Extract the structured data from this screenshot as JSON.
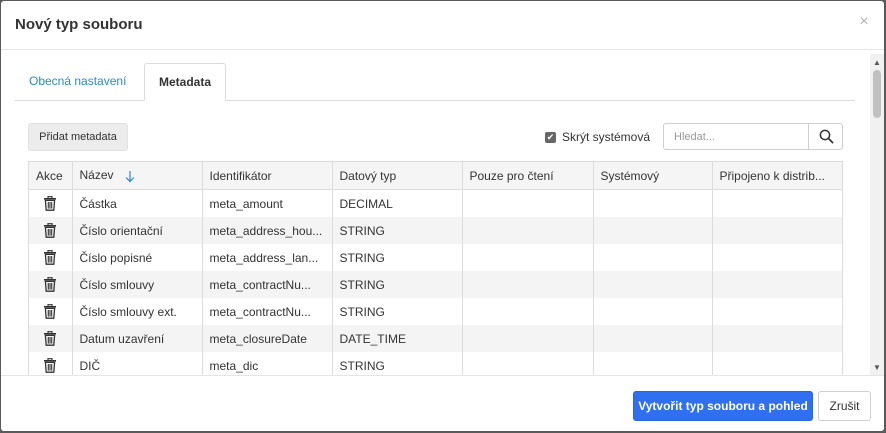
{
  "dialog": {
    "title": "Nový typ souboru",
    "close_glyph": "×",
    "close_icon": "close-icon"
  },
  "tabs": [
    {
      "label": "Obecná nastavení",
      "active": false
    },
    {
      "label": "Metadata",
      "active": true
    }
  ],
  "toolbar": {
    "add_label": "Přidat metadata",
    "hide_system_label": "Skrýt systémová",
    "hide_system_checked": true,
    "search_placeholder": "Hledat...",
    "search_icon": "search-icon"
  },
  "table": {
    "columns": [
      "Akce",
      "Název",
      "Identifikátor",
      "Datový typ",
      "Pouze pro čtení",
      "Systémový",
      "Připojeno k distrib..."
    ],
    "sort_column": "Název",
    "sort_direction": "ascending",
    "row_action_icon": "trash-icon",
    "rows": [
      {
        "name": "Částka",
        "identifier": "meta_amount",
        "type": "DECIMAL",
        "readonly": "",
        "system": "",
        "distribution": ""
      },
      {
        "name": "Číslo orientační",
        "identifier": "meta_address_hou...",
        "type": "STRING",
        "readonly": "",
        "system": "",
        "distribution": ""
      },
      {
        "name": "Číslo popisné",
        "identifier": "meta_address_lan...",
        "type": "STRING",
        "readonly": "",
        "system": "",
        "distribution": ""
      },
      {
        "name": "Číslo smlouvy",
        "identifier": "meta_contractNu...",
        "type": "STRING",
        "readonly": "",
        "system": "",
        "distribution": ""
      },
      {
        "name": "Číslo smlouvy ext.",
        "identifier": "meta_contractNu...",
        "type": "STRING",
        "readonly": "",
        "system": "",
        "distribution": ""
      },
      {
        "name": "Datum uzavření",
        "identifier": "meta_closureDate",
        "type": "DATE_TIME",
        "readonly": "",
        "system": "",
        "distribution": ""
      },
      {
        "name": "DIČ",
        "identifier": "meta_dic",
        "type": "STRING",
        "readonly": "",
        "system": "",
        "distribution": ""
      }
    ]
  },
  "footer": {
    "primary_label": "Vytvořit typ souboru a pohled",
    "cancel_label": "Zrušit"
  },
  "colors": {
    "primary": "#2f6ff0",
    "tab_link": "#2a8bc4"
  }
}
